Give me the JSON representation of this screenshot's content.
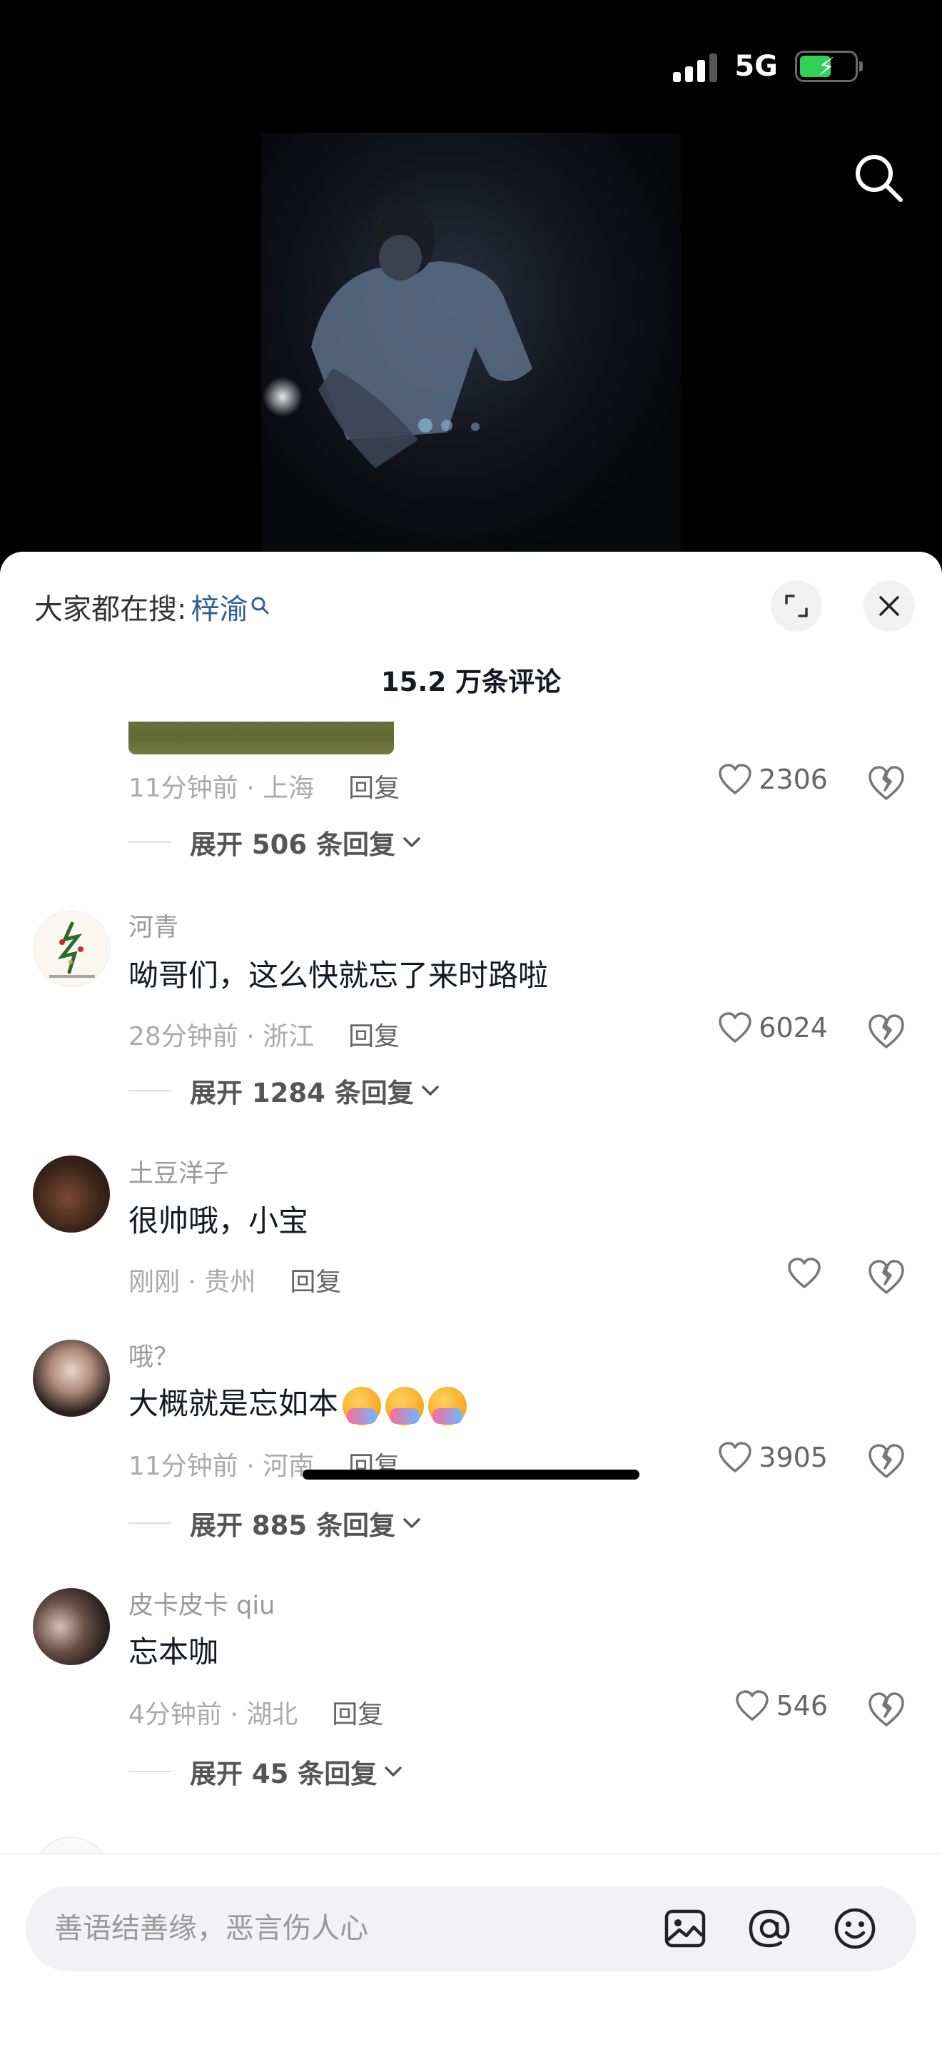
{
  "status_bar": {
    "network": "5G"
  },
  "sheet": {
    "hot_search_label": "大家都在搜:",
    "hot_search_keyword": "梓渝",
    "comment_count_title": "15.2 万条评论"
  },
  "comments": [
    {
      "meta": "11分钟前 · 上海",
      "reply": "回复",
      "likes": "2306",
      "expand": "展开 506 条回复"
    },
    {
      "username": "河青",
      "text": "呦哥们，这么快就忘了来时路啦",
      "meta": "28分钟前 · 浙江",
      "reply": "回复",
      "likes": "6024",
      "expand": "展开 1284 条回复"
    },
    {
      "username": "土豆洋子",
      "text": "很帅哦，小宝",
      "meta": "刚刚 · 贵州",
      "reply": "回复",
      "likes": ""
    },
    {
      "username": "哦？",
      "text": "大概就是忘如本",
      "meta": "11分钟前 · 河南",
      "reply": "回复",
      "likes": "3905",
      "expand": "展开 885 条回复"
    },
    {
      "username": "皮卡皮卡 qiu",
      "text": "忘本咖",
      "meta": "4分钟前 · 湖北",
      "reply": "回复",
      "likes": "546",
      "expand": "展开 45 条回复"
    }
  ],
  "input": {
    "placeholder": "善语结善缘，恶言伤人心"
  },
  "icons": [
    "search-icon",
    "expand-icon",
    "close-icon",
    "heart-icon",
    "dislike-icon",
    "image-icon",
    "at-icon",
    "emoji-icon",
    "chevron-down-icon"
  ]
}
